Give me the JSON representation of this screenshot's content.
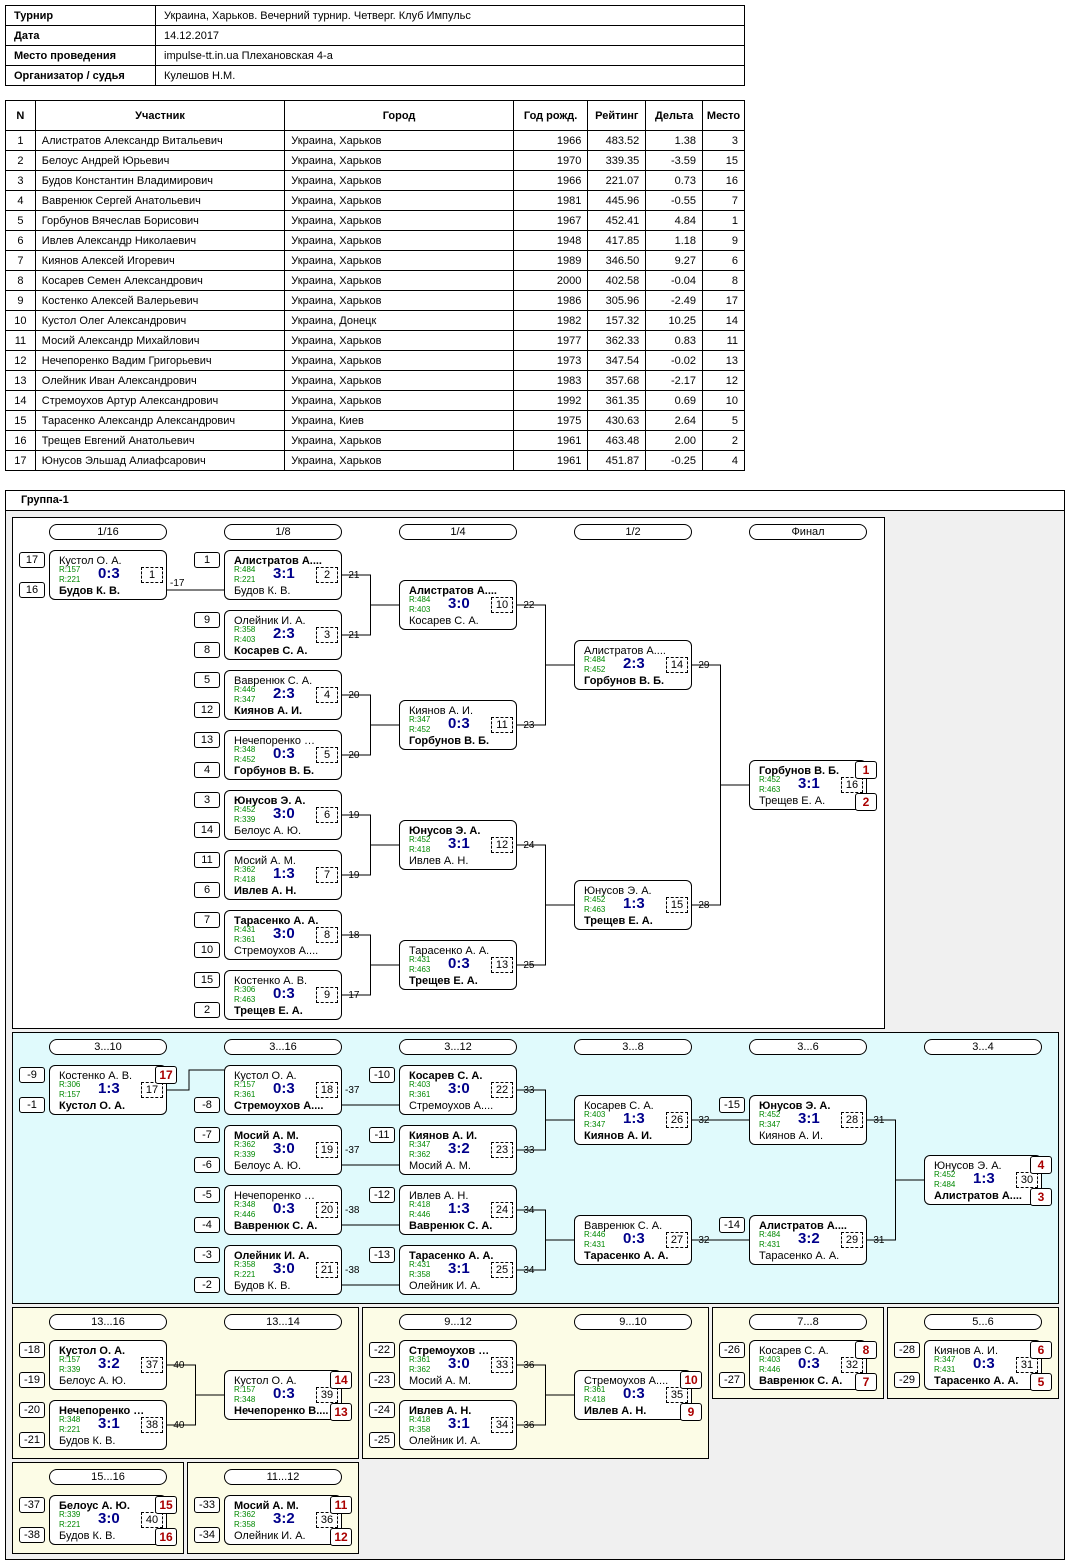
{
  "info": {
    "tournament_label": "Турнир",
    "tournament": "Украина, Харьков. Вечерний турнир. Четверг. Клуб Импульс",
    "date_label": "Дата",
    "date": "14.12.2017",
    "venue_label": "Место проведения",
    "venue": "impulse-tt.in.ua Плехановская 4-а",
    "organizer_label": "Организатор / судья",
    "organizer": "Кулешов Н.М."
  },
  "players_table": {
    "headers": [
      "N",
      "Участник",
      "Город",
      "Год рожд.",
      "Рейтинг",
      "Дельта",
      "Место"
    ],
    "rows": [
      [
        "1",
        "Алистратов Александр Витальевич",
        "Украина, Харьков",
        "1966",
        "483.52",
        "1.38",
        "3"
      ],
      [
        "2",
        "Белоус Андрей Юрьевич",
        "Украина, Харьков",
        "1970",
        "339.35",
        "-3.59",
        "15"
      ],
      [
        "3",
        "Будов Константин Владимирович",
        "Украина, Харьков",
        "1966",
        "221.07",
        "0.73",
        "16"
      ],
      [
        "4",
        "Вавренюк Сергей Анатольевич",
        "Украина, Харьков",
        "1981",
        "445.96",
        "-0.55",
        "7"
      ],
      [
        "5",
        "Горбунов Вячеслав Борисович",
        "Украина, Харьков",
        "1967",
        "452.41",
        "4.84",
        "1"
      ],
      [
        "6",
        "Ивлев Александр Николаевич",
        "Украина, Харьков",
        "1948",
        "417.85",
        "1.18",
        "9"
      ],
      [
        "7",
        "Киянов Алексей Игоревич",
        "Украина, Харьков",
        "1989",
        "346.50",
        "9.27",
        "6"
      ],
      [
        "8",
        "Косарев Семен Александрович",
        "Украина, Харьков",
        "2000",
        "402.58",
        "-0.04",
        "8"
      ],
      [
        "9",
        "Костенко Алексей Валерьевич",
        "Украина, Харьков",
        "1986",
        "305.96",
        "-2.49",
        "17"
      ],
      [
        "10",
        "Кустол Олег Александрович",
        "Украина, Донецк",
        "1982",
        "157.32",
        "10.25",
        "14"
      ],
      [
        "11",
        "Мосий Александр Михайлович",
        "Украина, Харьков",
        "1977",
        "362.33",
        "0.83",
        "11"
      ],
      [
        "12",
        "Нечепоренко Вадим Григорьевич",
        "Украина, Харьков",
        "1973",
        "347.54",
        "-0.02",
        "13"
      ],
      [
        "13",
        "Олейник Иван Александрович",
        "Украина, Харьков",
        "1983",
        "357.68",
        "-2.17",
        "12"
      ],
      [
        "14",
        "Стремоухов Артур Александрович",
        "Украина, Харьков",
        "1992",
        "361.35",
        "0.69",
        "10"
      ],
      [
        "15",
        "Тарасенко Александр Александрович",
        "Украина, Киев",
        "1975",
        "430.63",
        "2.64",
        "5"
      ],
      [
        "16",
        "Трещев Евгений Анатольевич",
        "Украина, Харьков",
        "1961",
        "463.48",
        "2.00",
        "2"
      ],
      [
        "17",
        "Юнусов Эльшад Алиафсарович",
        "Украина, Харьков",
        "1961",
        "451.87",
        "-0.25",
        "4"
      ]
    ]
  },
  "group_title": "Группа-1",
  "round_labels": {
    "main": [
      "1/16",
      "1/8",
      "1/4",
      "1/2",
      "Финал"
    ],
    "cons": [
      "3...10",
      "3...16",
      "3...12",
      "3...8",
      "3...6",
      "3...4"
    ],
    "b1316": [
      "13...16",
      "13...14"
    ],
    "b912": [
      "9...12",
      "9...10"
    ],
    "b78": [
      "7...8"
    ],
    "b56": [
      "5...6"
    ],
    "b1516": [
      "15...16"
    ],
    "b1112": [
      "11...12"
    ]
  },
  "matches": [
    {
      "id": "1",
      "p1": "Кустол О. А.",
      "p2": "Будов К. В.",
      "r1": "R:157",
      "r2": "R:221",
      "score": "0:3",
      "w": 2,
      "seed1": "17",
      "seed2": "16",
      "next": "-17"
    },
    {
      "id": "2",
      "p1": "Алистратов А....",
      "p2": "Будов К. В.",
      "r1": "R:484",
      "r2": "R:221",
      "score": "3:1",
      "w": 1,
      "seed1": "1",
      "next": "-21"
    },
    {
      "id": "3",
      "p1": "Олейник И. А.",
      "p2": "Косарев С. А.",
      "r1": "R:358",
      "r2": "R:403",
      "score": "2:3",
      "w": 2,
      "seed1": "9",
      "seed2": "8",
      "next": "-21"
    },
    {
      "id": "4",
      "p1": "Вавренюк С. А.",
      "p2": "Киянов А. И.",
      "r1": "R:446",
      "r2": "R:347",
      "score": "2:3",
      "w": 2,
      "seed1": "5",
      "seed2": "12",
      "next": "-20"
    },
    {
      "id": "5",
      "p1": "Нечепоренко В....",
      "p2": "Горбунов В. Б.",
      "r1": "R:348",
      "r2": "R:452",
      "score": "0:3",
      "w": 2,
      "seed1": "13",
      "seed2": "4",
      "next": "-20"
    },
    {
      "id": "6",
      "p1": "Юнусов Э. А.",
      "p2": "Белоус А. Ю.",
      "r1": "R:452",
      "r2": "R:339",
      "score": "3:0",
      "w": 1,
      "seed1": "3",
      "seed2": "14",
      "next": "-19"
    },
    {
      "id": "7",
      "p1": "Мосий А. М.",
      "p2": "Ивлев А. Н.",
      "r1": "R:362",
      "r2": "R:418",
      "score": "1:3",
      "w": 2,
      "seed1": "11",
      "seed2": "6",
      "next": "-19"
    },
    {
      "id": "8",
      "p1": "Тарасенко А. А.",
      "p2": "Стремоухов А....",
      "r1": "R:431",
      "r2": "R:361",
      "score": "3:0",
      "w": 1,
      "seed1": "7",
      "seed2": "10",
      "next": "-18"
    },
    {
      "id": "9",
      "p1": "Костенко А. В.",
      "p2": "Трещев Е. А.",
      "r1": "R:306",
      "r2": "R:463",
      "score": "0:3",
      "w": 2,
      "seed1": "15",
      "seed2": "2",
      "next": "-17"
    },
    {
      "id": "10",
      "p1": "Алистратов А....",
      "p2": "Косарев С. А.",
      "r1": "R:484",
      "r2": "R:403",
      "score": "3:0",
      "w": 1,
      "next": "-22"
    },
    {
      "id": "11",
      "p1": "Киянов А. И.",
      "p2": "Горбунов В. Б.",
      "r1": "R:347",
      "r2": "R:452",
      "score": "0:3",
      "w": 2,
      "next": "-23"
    },
    {
      "id": "12",
      "p1": "Юнусов Э. А.",
      "p2": "Ивлев А. Н.",
      "r1": "R:452",
      "r2": "R:418",
      "score": "3:1",
      "w": 1,
      "next": "-24"
    },
    {
      "id": "13",
      "p1": "Тарасенко А. А.",
      "p2": "Трещев Е. А.",
      "r1": "R:431",
      "r2": "R:463",
      "score": "0:3",
      "w": 2,
      "next": "-25"
    },
    {
      "id": "14",
      "p1": "Алистратов А....",
      "p2": "Горбунов В. Б.",
      "r1": "R:484",
      "r2": "R:452",
      "score": "2:3",
      "w": 2,
      "next": "-29"
    },
    {
      "id": "15",
      "p1": "Юнусов Э. А.",
      "p2": "Трещев Е. А.",
      "r1": "R:452",
      "r2": "R:463",
      "score": "1:3",
      "w": 2,
      "next": "-28"
    },
    {
      "id": "16",
      "p1": "Горбунов В. Б.",
      "p2": "Трещев Е. А.",
      "r1": "R:452",
      "r2": "R:463",
      "score": "3:1",
      "w": 1,
      "place1": "1",
      "place2": "2"
    },
    {
      "id": "17",
      "p1": "Костенко А. В.",
      "p2": "Кустол О. А.",
      "r1": "R:306",
      "r2": "R:157",
      "score": "1:3",
      "w": 2,
      "seed1": "-9",
      "seed2": "-1",
      "place1": "17"
    },
    {
      "id": "18",
      "p1": "Кустол О. А.",
      "p2": "Стремоухов А....",
      "r1": "R:157",
      "r2": "R:361",
      "score": "0:3",
      "w": 2,
      "seed2": "-8",
      "next": "-37"
    },
    {
      "id": "19",
      "p1": "Мосий А. М.",
      "p2": "Белоус А. Ю.",
      "r1": "R:362",
      "r2": "R:339",
      "score": "3:0",
      "w": 1,
      "seed1": "-7",
      "seed2": "-6",
      "next": "-37"
    },
    {
      "id": "20",
      "p1": "Нечепоренко В....",
      "p2": "Вавренюк С. А.",
      "r1": "R:348",
      "r2": "R:446",
      "score": "0:3",
      "w": 2,
      "seed1": "-5",
      "seed2": "-4",
      "next": "-38"
    },
    {
      "id": "21",
      "p1": "Олейник И. А.",
      "p2": "Будов К. В.",
      "r1": "R:358",
      "r2": "R:221",
      "score": "3:0",
      "w": 1,
      "seed1": "-3",
      "seed2": "-2",
      "next": "-38"
    },
    {
      "id": "22",
      "p1": "Косарев С. А.",
      "p2": "Стремоухов А....",
      "r1": "R:403",
      "r2": "R:361",
      "score": "3:0",
      "w": 1,
      "seed1": "-10",
      "next": "-33"
    },
    {
      "id": "23",
      "p1": "Киянов А. И.",
      "p2": "Мосий А. М.",
      "r1": "R:347",
      "r2": "R:362",
      "score": "3:2",
      "w": 1,
      "seed1": "-11",
      "next": "-33"
    },
    {
      "id": "24",
      "p1": "Ивлев А. Н.",
      "p2": "Вавренюк С. А.",
      "r1": "R:418",
      "r2": "R:446",
      "score": "1:3",
      "w": 2,
      "seed1": "-12",
      "next": "-34"
    },
    {
      "id": "25",
      "p1": "Тарасенко А. А.",
      "p2": "Олейник И. А.",
      "r1": "R:431",
      "r2": "R:358",
      "score": "3:1",
      "w": 1,
      "seed1": "-13",
      "next": "-34"
    },
    {
      "id": "26",
      "p1": "Косарев С. А.",
      "p2": "Киянов А. И.",
      "r1": "R:403",
      "r2": "R:347",
      "score": "1:3",
      "w": 2,
      "next": "-32"
    },
    {
      "id": "27",
      "p1": "Вавренюк С. А.",
      "p2": "Тарасенко А. А.",
      "r1": "R:446",
      "r2": "R:431",
      "score": "0:3",
      "w": 2,
      "next": "-32"
    },
    {
      "id": "28",
      "p1": "Юнусов Э. А.",
      "p2": "Киянов А. И.",
      "r1": "R:452",
      "r2": "R:347",
      "score": "3:1",
      "w": 1,
      "seed1": "-15",
      "next": "-31"
    },
    {
      "id": "29",
      "p1": "Алистратов А....",
      "p2": "Тарасенко А. А.",
      "r1": "R:484",
      "r2": "R:431",
      "score": "3:2",
      "w": 1,
      "seed1": "-14",
      "next": "-31"
    },
    {
      "id": "30",
      "p1": "Юнусов Э. А.",
      "p2": "Алистратов А....",
      "r1": "R:452",
      "r2": "R:484",
      "score": "1:3",
      "w": 2,
      "place1": "4",
      "place2": "3"
    },
    {
      "id": "37",
      "p1": "Кустол О. А.",
      "p2": "Белоус А. Ю.",
      "r1": "R:157",
      "r2": "R:339",
      "score": "3:2",
      "w": 1,
      "seed1": "-18",
      "seed2": "-19",
      "next": "-40"
    },
    {
      "id": "38",
      "p1": "Нечепоренко В....",
      "p2": "Будов К. В.",
      "r1": "R:348",
      "r2": "R:221",
      "score": "3:1",
      "w": 1,
      "seed1": "-20",
      "seed2": "-21",
      "next": "-40"
    },
    {
      "id": "39",
      "p1": "Кустол О. А.",
      "p2": "Нечепоренко В....",
      "r1": "R:157",
      "r2": "R:348",
      "score": "0:3",
      "w": 2,
      "place1": "14",
      "place2": "13"
    },
    {
      "id": "33",
      "p1": "Стремоухов А....",
      "p2": "Мосий А. М.",
      "r1": "R:361",
      "r2": "R:362",
      "score": "3:0",
      "w": 1,
      "seed1": "-22",
      "seed2": "-23",
      "next": "-36"
    },
    {
      "id": "34",
      "p1": "Ивлев А. Н.",
      "p2": "Олейник И. А.",
      "r1": "R:418",
      "r2": "R:358",
      "score": "3:1",
      "w": 1,
      "seed1": "-24",
      "seed2": "-25",
      "next": "-36"
    },
    {
      "id": "35",
      "p1": "Стремоухов А....",
      "p2": "Ивлев А. Н.",
      "r1": "R:361",
      "r2": "R:418",
      "score": "0:3",
      "w": 2,
      "place1": "10",
      "place2": "9"
    },
    {
      "id": "32",
      "p1": "Косарев С. А.",
      "p2": "Вавренюк С. А.",
      "r1": "R:403",
      "r2": "R:446",
      "score": "0:3",
      "w": 2,
      "seed1": "-26",
      "seed2": "-27",
      "place1": "8",
      "place2": "7"
    },
    {
      "id": "31",
      "p1": "Киянов А. И.",
      "p2": "Тарасенко А. А.",
      "r1": "R:347",
      "r2": "R:431",
      "score": "0:3",
      "w": 2,
      "seed1": "-28",
      "seed2": "-29",
      "place1": "6",
      "place2": "5"
    },
    {
      "id": "40",
      "p1": "Белоус А. Ю.",
      "p2": "Будов К. В.",
      "r1": "R:339",
      "r2": "R:221",
      "score": "3:0",
      "w": 1,
      "seed1": "-37",
      "seed2": "-38",
      "place1": "15",
      "place2": "16"
    },
    {
      "id": "36",
      "p1": "Мосий А. М.",
      "p2": "Олейник И. А.",
      "r1": "R:362",
      "r2": "R:358",
      "score": "3:2",
      "w": 1,
      "seed1": "-33",
      "seed2": "-34",
      "place1": "11",
      "place2": "12"
    }
  ]
}
